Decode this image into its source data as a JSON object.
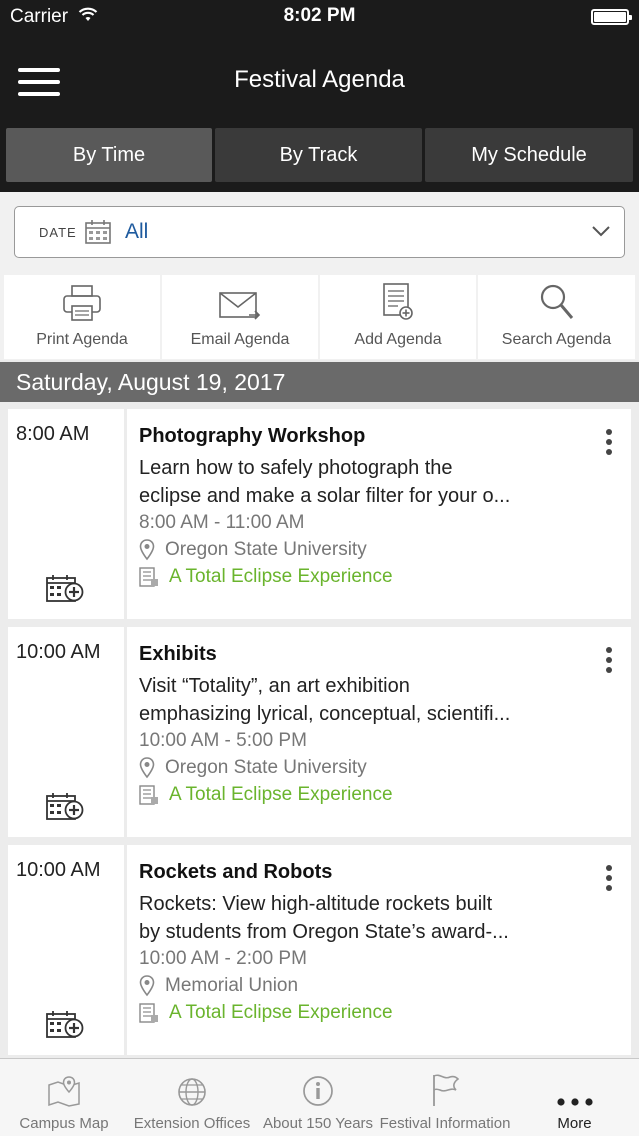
{
  "status_bar": {
    "carrier": "Carrier",
    "time": "8:02 PM"
  },
  "header": {
    "title": "Festival Agenda"
  },
  "segments": [
    {
      "label": "By Time",
      "active": true
    },
    {
      "label": "By Track",
      "active": false
    },
    {
      "label": "My Schedule",
      "active": false
    }
  ],
  "date_filter": {
    "label": "DATE",
    "value": "All"
  },
  "actions": [
    {
      "label": "Print Agenda",
      "icon": "printer-icon"
    },
    {
      "label": "Email Agenda",
      "icon": "envelope-icon"
    },
    {
      "label": "Add Agenda",
      "icon": "add-document-icon"
    },
    {
      "label": "Search Agenda",
      "icon": "search-icon"
    }
  ],
  "day_header": "Saturday, August 19, 2017",
  "sessions": [
    {
      "start": "8:00 AM",
      "title": "Photography Workshop",
      "desc_line1": "Learn how to safely photograph the",
      "desc_line2": "eclipse and make a solar filter for your o...",
      "time_range": "8:00 AM - 11:00 AM",
      "location": "Oregon State University",
      "track": "A Total Eclipse Experience"
    },
    {
      "start": "10:00 AM",
      "title": "Exhibits",
      "desc_line1": "Visit “Totality”, an art exhibition",
      "desc_line2": "emphasizing lyrical, conceptual, scientifi...",
      "time_range": "10:00 AM - 5:00 PM",
      "location": "Oregon State University",
      "track": "A Total Eclipse Experience"
    },
    {
      "start": "10:00 AM",
      "title": "Rockets and Robots",
      "desc_line1": "Rockets: View high-altitude rockets built",
      "desc_line2": "by students from Oregon State’s award-...",
      "time_range": "10:00 AM - 2:00 PM",
      "location": "Memorial Union",
      "track": "A Total Eclipse Experience"
    }
  ],
  "tabs": [
    {
      "label": "Campus Map",
      "icon": "map-pin-icon",
      "active": false
    },
    {
      "label": "Extension Offices",
      "icon": "globe-icon",
      "active": false
    },
    {
      "label": "About 150 Years",
      "icon": "info-icon",
      "active": false
    },
    {
      "label": "Festival Information",
      "icon": "flag-icon",
      "active": false
    },
    {
      "label": "More",
      "icon": "more-horizontal-icon",
      "active": true
    }
  ],
  "colors": {
    "bar_dark": "#1b1b1b",
    "segment_active": "#595959",
    "link_blue": "#1e5a9e",
    "track_green": "#6ab42d",
    "day_header": "#6a6a6a"
  }
}
